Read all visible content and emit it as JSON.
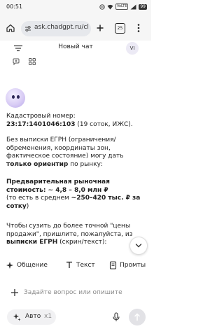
{
  "status_bar": {
    "time": "00:51",
    "network_badge": "VoLTE",
    "battery": "99"
  },
  "browser": {
    "url": "ask.chadgpt.ru/cl",
    "tab_count": "25"
  },
  "chat_header": {
    "title": "Новый чат",
    "user_initials": "VI"
  },
  "message": {
    "p1": {
      "label": "Кадастровый номер: ",
      "cadastral_number": "23:17:1401046:103",
      "details": " (19 соток, ИЖС)."
    },
    "p2": {
      "text": "Без выписки ЕГРН (ограничения/обременения, координаты зон, фактическое состояние) могу дать ",
      "bold": "только ориентир",
      "tail": " по рынку:"
    },
    "p3": {
      "bold_label": "Предварительная рыночная стоимость:",
      "bold_value": " ~ 4,8 – 8,0 млн ₽",
      "line2_prefix": "(то есть в среднем ",
      "line2_bold": "~250–420 тыс. ₽ за сотку",
      "line2_suffix": ")"
    },
    "p4": {
      "text": "Чтобы сузить до более точной \"цены продажи\", пришлите, пожалуйста, из ",
      "bold": "выписки ЕГРН",
      "tail": " (скрин/текст):"
    }
  },
  "chips": [
    {
      "label": "Общение",
      "icon": "sparkle-icon"
    },
    {
      "label": "Текст",
      "icon": "text-icon"
    },
    {
      "label": "Промты",
      "icon": "prompts-icon"
    }
  ],
  "input": {
    "placeholder": "Задайте вопрос или опишите",
    "mode_label": "Авто",
    "mode_count": "x1"
  },
  "colors": {
    "accent_purple": "#b9a8ea",
    "chrome_bg": "#f6f6f6",
    "pill_bg": "#e6e8ec"
  }
}
